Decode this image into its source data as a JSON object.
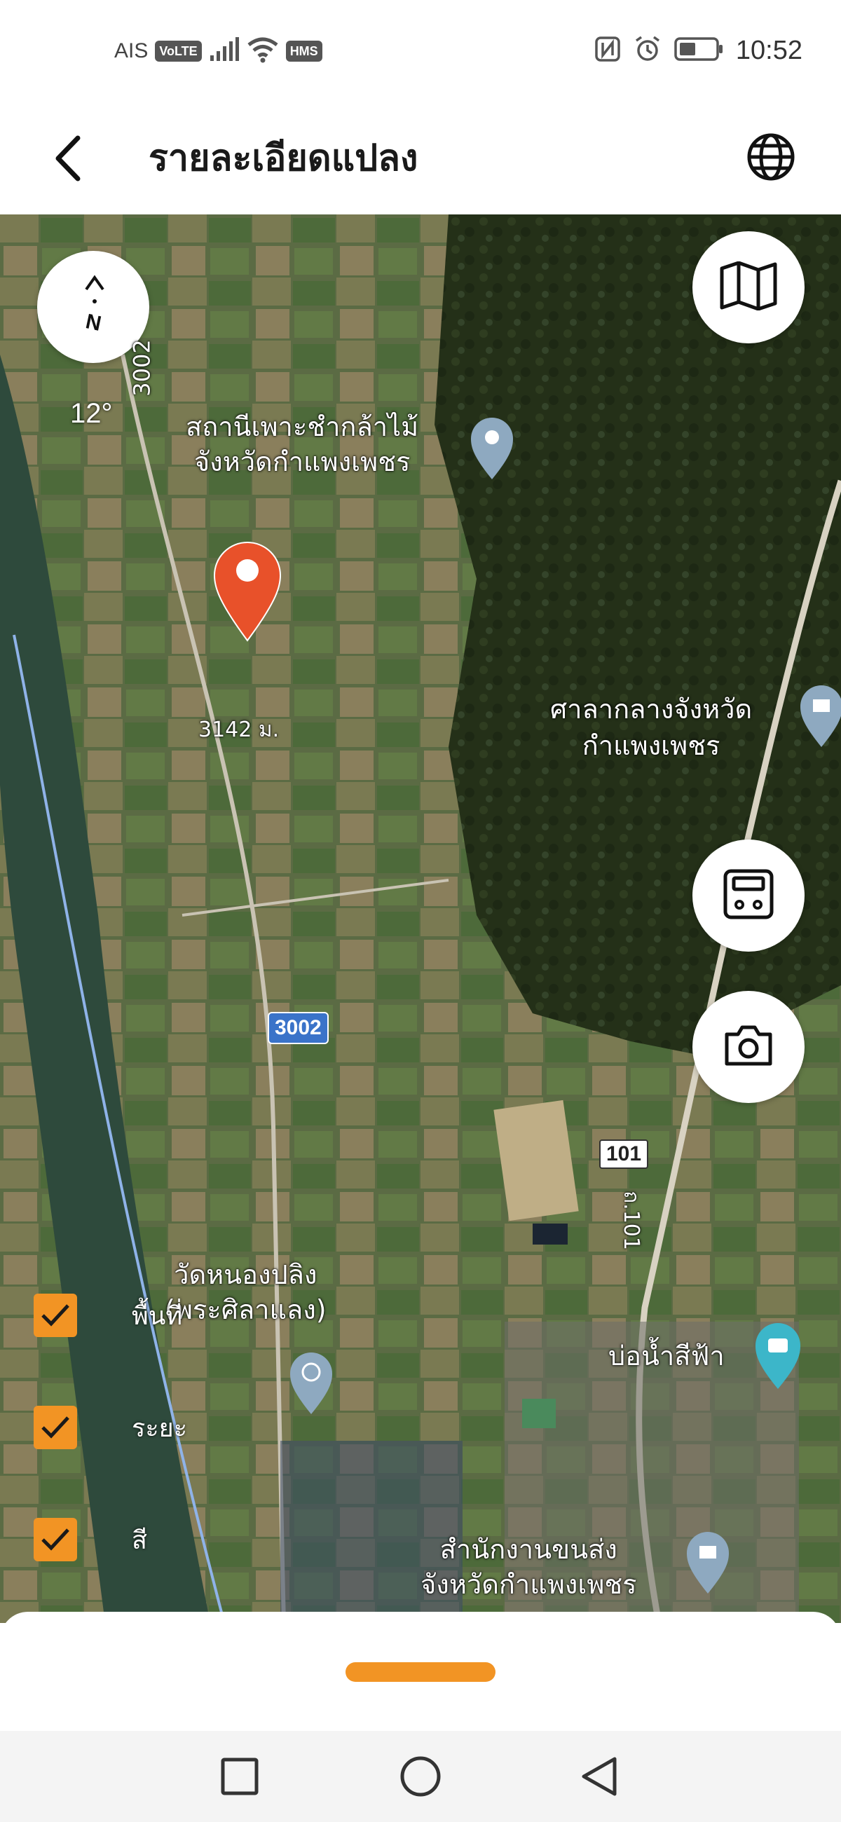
{
  "status_bar": {
    "carrier": "AIS",
    "volte_badge": "VoLTE",
    "hms_badge": "HMS",
    "time": "10:52",
    "icons": [
      "signal-icon",
      "wifi-icon",
      "nfc-icon",
      "alarm-icon",
      "battery-icon"
    ]
  },
  "app_bar": {
    "title": "รายละเอียดแปลง",
    "back_icon": "chevron-left-icon",
    "globe_icon": "globe-icon"
  },
  "map": {
    "compass_angle": "12°",
    "road_3002": "3002",
    "road_101": "101",
    "road_101_side": "ถ.101",
    "parcel_label": "3142 ม.",
    "poi": {
      "nursery_line1": "สถานีเพาะชำกล้าไม้",
      "nursery_line2": "จังหวัดกำแพงเพชร",
      "city_hall_line1": "ศาลากลางจังหวัด",
      "city_hall_line2": "กำแพงเพชร",
      "temple_line1": "วัดหนองปลิง",
      "temple_line2": "(พระศิลาแลง)",
      "blue_pond": "บ่อน้ำสีฟ้า",
      "transport_line1": "สำนักงานขนส่ง",
      "transport_line2": "จังหวัดกำแพงเพชร"
    },
    "buttons": {
      "map_layer_icon": "map-icon",
      "save_icon": "save-icon",
      "camera_icon": "camera-icon"
    },
    "toggles": [
      {
        "label": "พื้นที่",
        "checked": true
      },
      {
        "label": "ระยะ",
        "checked": true
      },
      {
        "label": "สี",
        "checked": true
      }
    ]
  },
  "colors": {
    "accent": "#f29424",
    "pin_red": "#e8512a",
    "road_shield": "#3a73c9"
  },
  "nav_bar": {
    "icons": [
      "recent-apps-icon",
      "home-icon",
      "back-triangle-icon"
    ]
  }
}
